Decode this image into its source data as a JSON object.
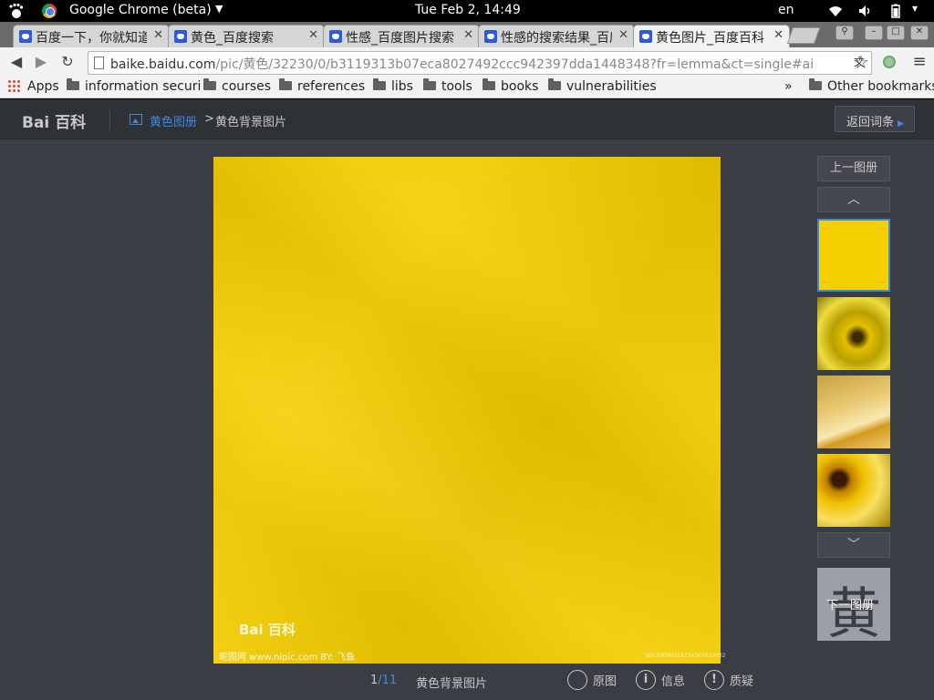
{
  "system_bar": {
    "app_name": "Google Chrome (beta)",
    "clock": "Tue Feb  2, 14:49",
    "language": "en"
  },
  "tabs": [
    {
      "title": "百度一下，你就知道",
      "active": false
    },
    {
      "title": "黄色_百度搜索",
      "active": false
    },
    {
      "title": "性感_百度图片搜索",
      "active": false
    },
    {
      "title": "性感的搜索结果_百度",
      "active": false
    },
    {
      "title": "黄色图片_百度百科",
      "active": true
    }
  ],
  "toolbar": {
    "url_main": "baike.baidu.com",
    "url_rest": "/pic/黄色/32230/0/b3119313b07eca8027492ccc942397dda1448348?fr=lemma&ct=single#ai"
  },
  "bookmarks": {
    "apps": "Apps",
    "items": [
      "information securi",
      "courses",
      "references",
      "libs",
      "tools",
      "books",
      "vulnerabilities"
    ],
    "overflow": "»",
    "other": "Other bookmarks"
  },
  "page": {
    "logo": "Bai 百科",
    "breadcrumb_album": "黄色图册",
    "breadcrumb_sep": ">",
    "breadcrumb_current": "黄色背景图片",
    "back_button": "返回词条",
    "prev_album": "上一图册",
    "next_album": "下一图册",
    "next_album_glyph": "黄",
    "watermark_logo": "Bai 百科",
    "watermark_bottom": "昵图网 www.nipic.com    BY: 飞鱼",
    "watermark_code": "NO:20090718234567010032",
    "pager_current": "1",
    "pager_total": "/11",
    "caption": "黄色背景图片",
    "tools": [
      {
        "label": "原图",
        "icon": "magnifier-icon"
      },
      {
        "label": "信息",
        "icon": "info-icon"
      },
      {
        "label": "质疑",
        "icon": "exclamation-icon"
      }
    ]
  }
}
